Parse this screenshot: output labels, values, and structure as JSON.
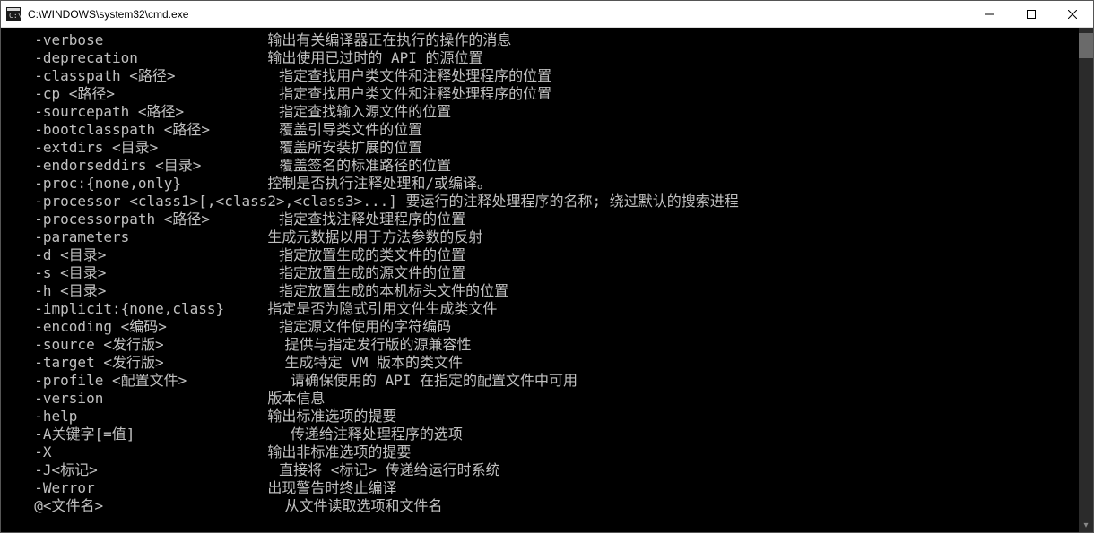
{
  "titlebar": {
    "title": "C:\\WINDOWS\\system32\\cmd.exe"
  },
  "lines": [
    "  -verbose                   输出有关编译器正在执行的操作的消息",
    "  -deprecation               输出使用已过时的 API 的源位置",
    "  -classpath <路径>            指定查找用户类文件和注释处理程序的位置",
    "  -cp <路径>                   指定查找用户类文件和注释处理程序的位置",
    "  -sourcepath <路径>           指定查找输入源文件的位置",
    "  -bootclasspath <路径>        覆盖引导类文件的位置",
    "  -extdirs <目录>              覆盖所安装扩展的位置",
    "  -endorseddirs <目录>         覆盖签名的标准路径的位置",
    "  -proc:{none,only}          控制是否执行注释处理和/或编译。",
    "  -processor <class1>[,<class2>,<class3>...] 要运行的注释处理程序的名称; 绕过默认的搜索进程",
    "  -processorpath <路径>        指定查找注释处理程序的位置",
    "  -parameters                生成元数据以用于方法参数的反射",
    "  -d <目录>                    指定放置生成的类文件的位置",
    "  -s <目录>                    指定放置生成的源文件的位置",
    "  -h <目录>                    指定放置生成的本机标头文件的位置",
    "  -implicit:{none,class}     指定是否为隐式引用文件生成类文件",
    "  -encoding <编码>             指定源文件使用的字符编码",
    "  -source <发行版>              提供与指定发行版的源兼容性",
    "  -target <发行版>              生成特定 VM 版本的类文件",
    "  -profile <配置文件>            请确保使用的 API 在指定的配置文件中可用",
    "  -version                   版本信息",
    "  -help                      输出标准选项的提要",
    "  -A关键字[=值]                  传递给注释处理程序的选项",
    "  -X                         输出非标准选项的提要",
    "  -J<标记>                     直接将 <标记> 传递给运行时系统",
    "  -Werror                    出现警告时终止编译",
    "  @<文件名>                     从文件读取选项和文件名"
  ]
}
